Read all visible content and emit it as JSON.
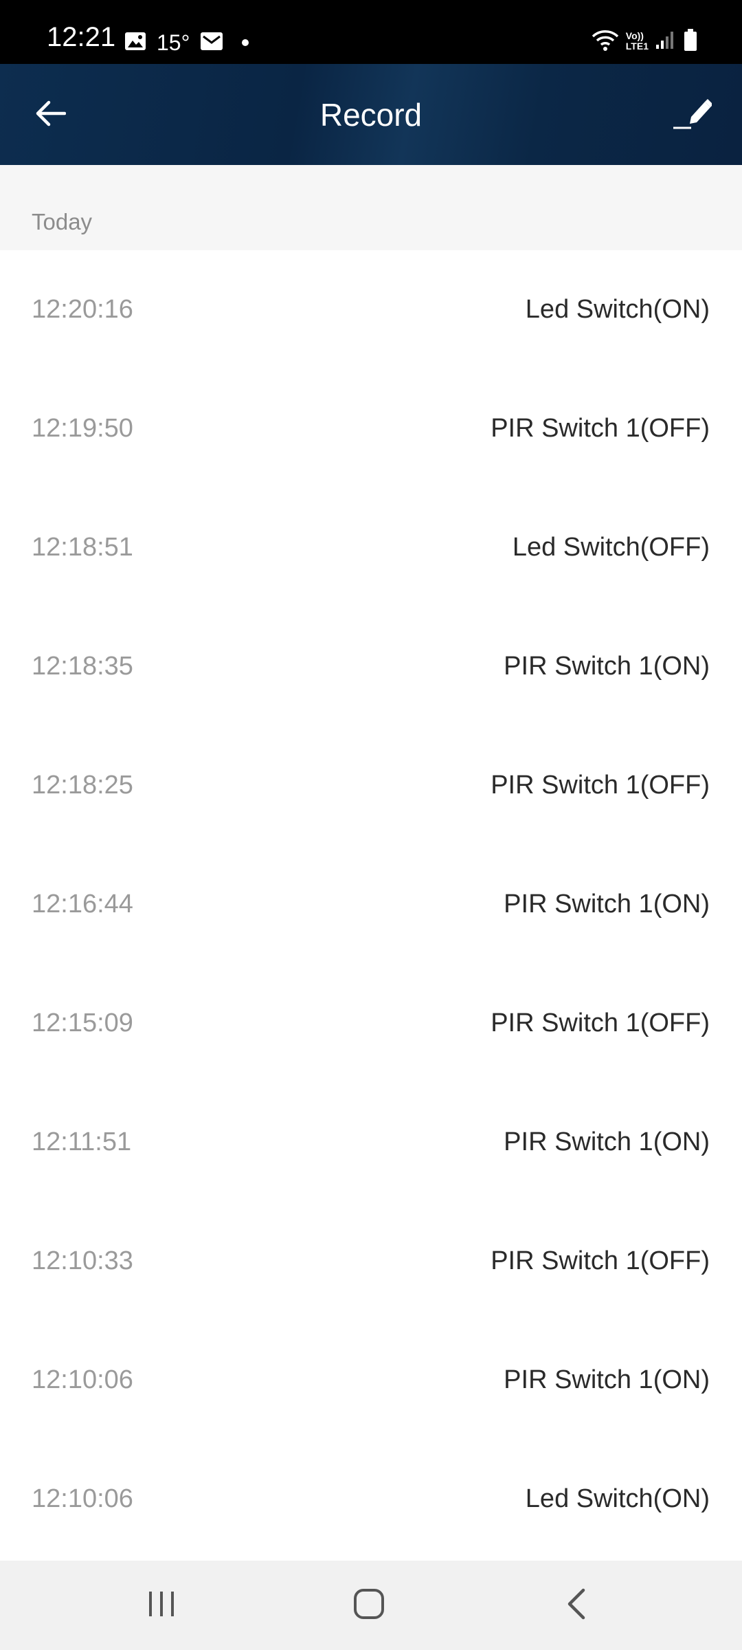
{
  "status_bar": {
    "time": "12:21",
    "temperature": "15°",
    "network_top": "Vo))",
    "network_bottom": "LTE1",
    "icons": [
      "image-icon",
      "mail-icon",
      "dot-icon",
      "wifi-icon",
      "signal-icon",
      "battery-icon"
    ]
  },
  "header": {
    "title": "Record",
    "back_icon": "arrow-left-icon",
    "edit_icon": "edit-pencil-icon"
  },
  "section": {
    "label": "Today"
  },
  "records": [
    {
      "time": "12:20:16",
      "event": "Led Switch(ON)"
    },
    {
      "time": "12:19:50",
      "event": "PIR Switch 1(OFF)"
    },
    {
      "time": "12:18:51",
      "event": "Led Switch(OFF)"
    },
    {
      "time": "12:18:35",
      "event": "PIR Switch 1(ON)"
    },
    {
      "time": "12:18:25",
      "event": "PIR Switch 1(OFF)"
    },
    {
      "time": "12:16:44",
      "event": "PIR Switch 1(ON)"
    },
    {
      "time": "12:15:09",
      "event": "PIR Switch 1(OFF)"
    },
    {
      "time": "12:11:51",
      "event": "PIR Switch 1(ON)"
    },
    {
      "time": "12:10:33",
      "event": "PIR Switch 1(OFF)"
    },
    {
      "time": "12:10:06",
      "event": "PIR Switch 1(ON)"
    },
    {
      "time": "12:10:06",
      "event": "Led Switch(ON)"
    }
  ],
  "nav_bar": {
    "icons": [
      "recent-apps-icon",
      "home-icon",
      "nav-back-icon"
    ]
  },
  "colors": {
    "header_bg": "#0b2746",
    "time_text": "#9a9a9a",
    "event_text": "#2a2a2a",
    "section_bg": "#f6f6f6"
  }
}
